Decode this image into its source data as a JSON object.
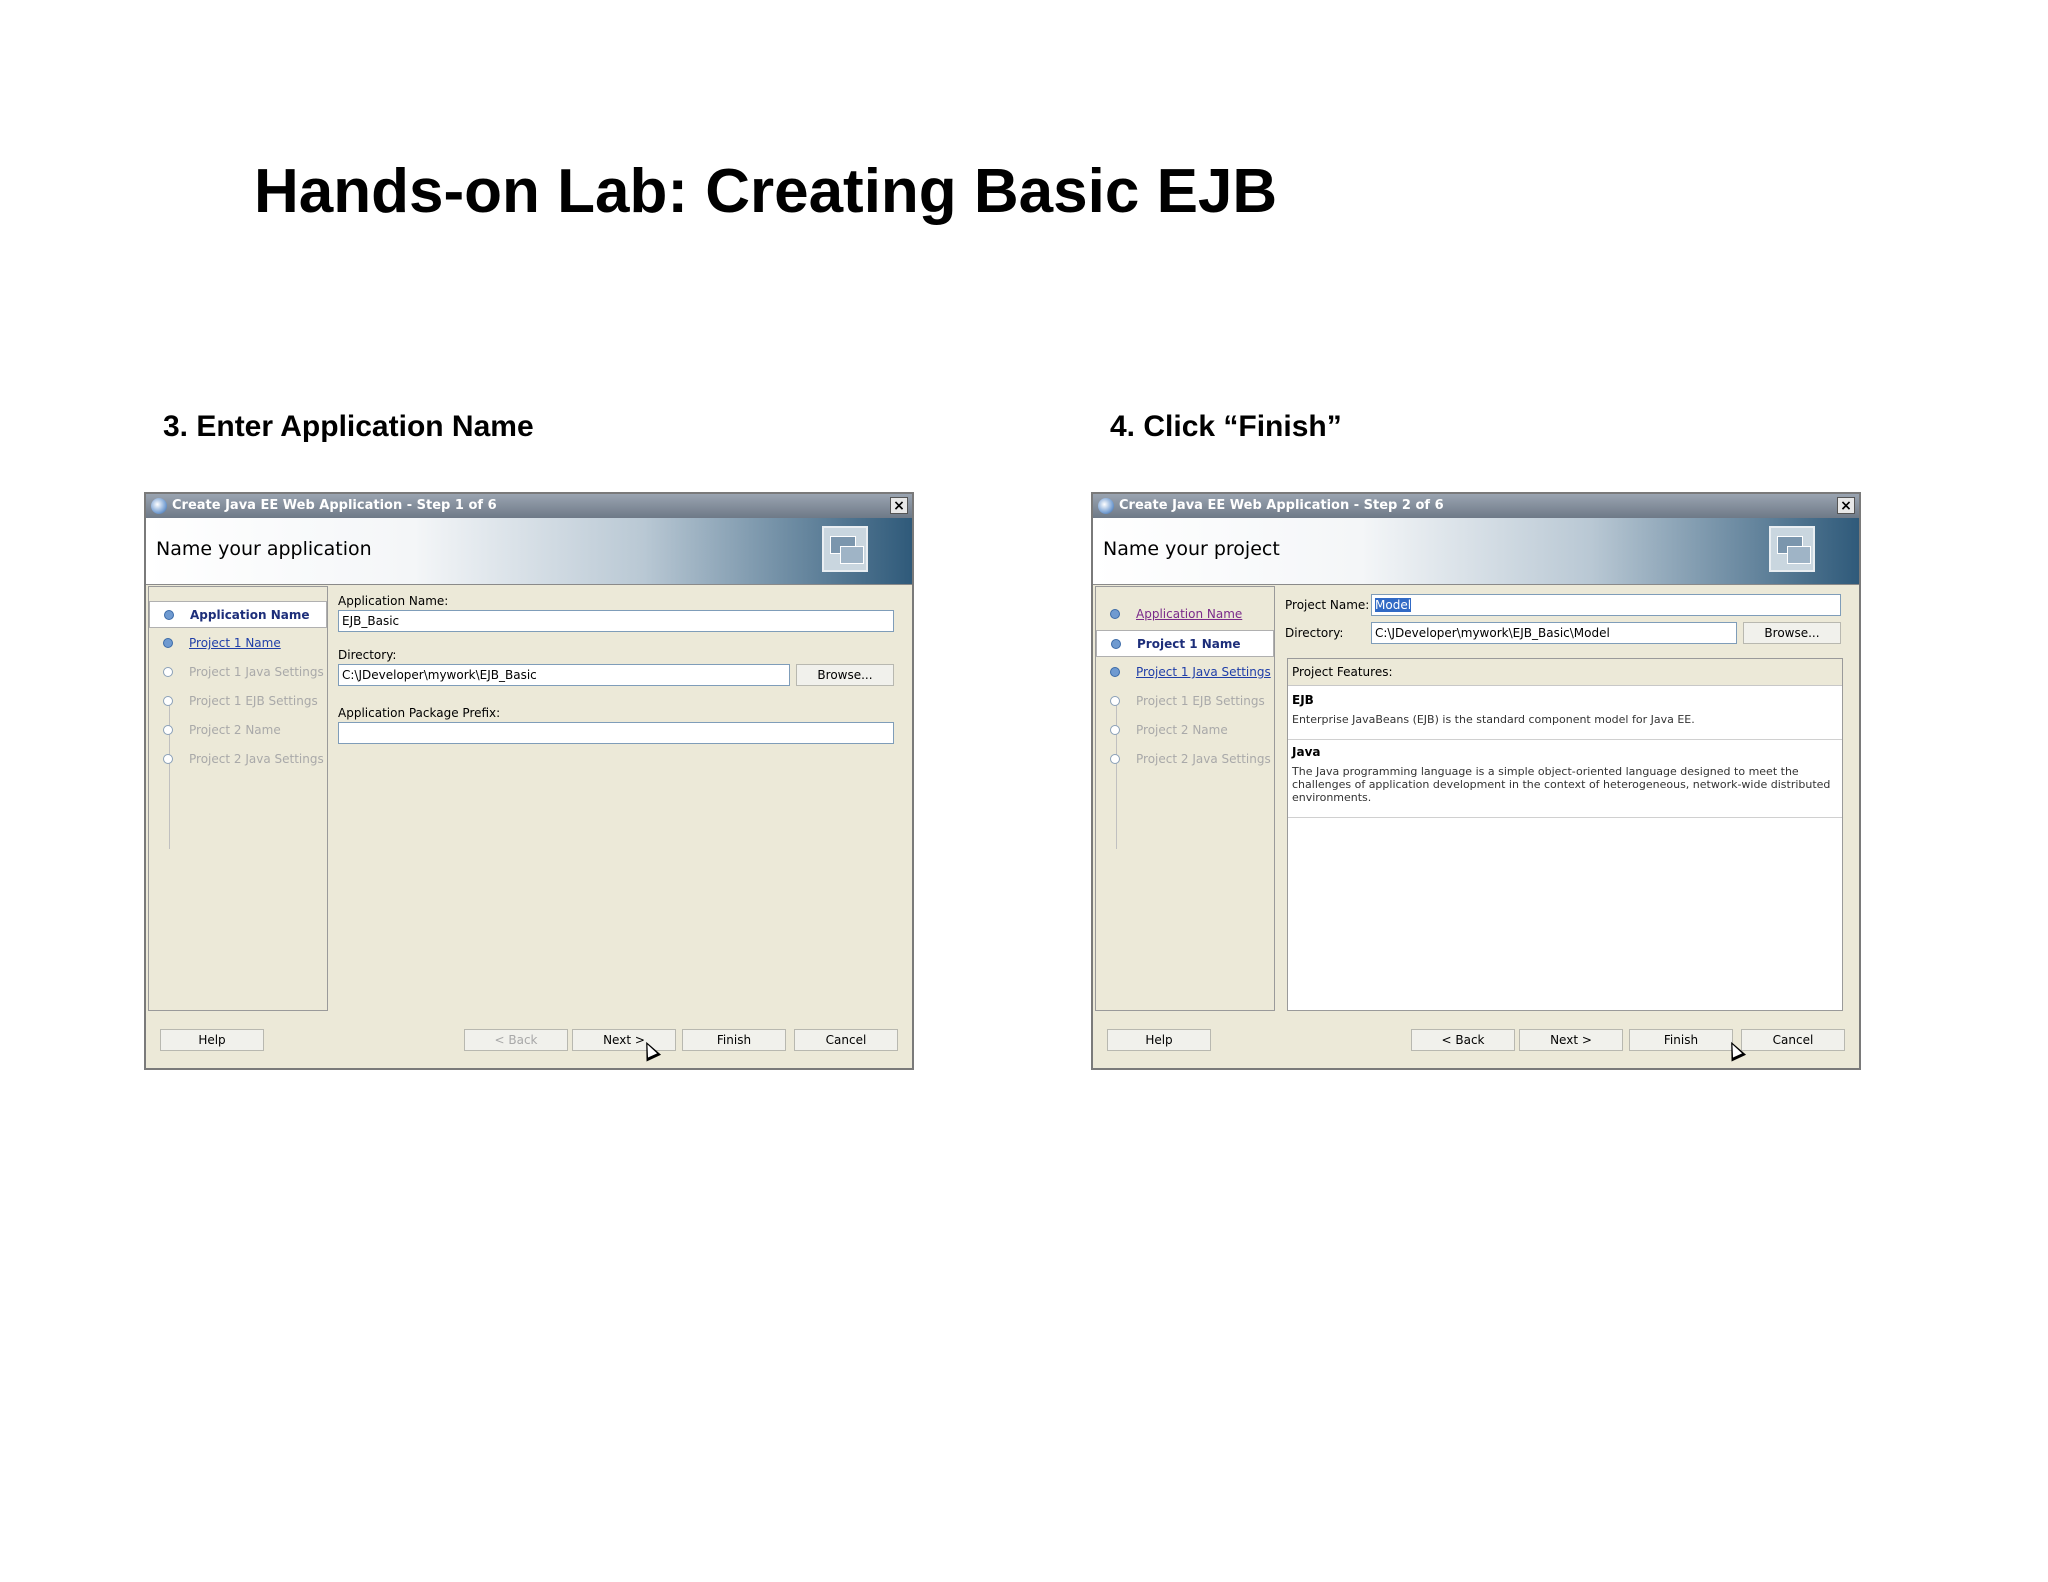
{
  "slide": {
    "title": "Hands-on Lab: Creating Basic EJB"
  },
  "step3": {
    "caption": "3. Enter Application Name",
    "dialog": {
      "window_title": "Create Java EE Web Application - Step 1 of 6",
      "banner_title": "Name your application",
      "nav": [
        {
          "label": "Application Name",
          "state": "selected"
        },
        {
          "label": "Project 1 Name",
          "state": "link"
        },
        {
          "label": "Project 1 Java Settings",
          "state": "disabled"
        },
        {
          "label": "Project 1 EJB Settings",
          "state": "disabled"
        },
        {
          "label": "Project 2 Name",
          "state": "disabled"
        },
        {
          "label": "Project 2 Java Settings",
          "state": "disabled"
        }
      ],
      "app_name_label": "Application Name:",
      "app_name_value": "EJB_Basic",
      "directory_label": "Directory:",
      "directory_value": "C:\\JDeveloper\\mywork\\EJB_Basic",
      "browse_label": "Browse...",
      "package_prefix_label": "Application Package Prefix:",
      "package_prefix_value": "",
      "buttons": {
        "help": "Help",
        "back": "< Back",
        "next": "Next >",
        "finish": "Finish",
        "cancel": "Cancel"
      }
    }
  },
  "step4": {
    "caption": "4. Click “Finish”",
    "dialog": {
      "window_title": "Create Java EE Web Application - Step 2 of 6",
      "banner_title": "Name your project",
      "nav": [
        {
          "label": "Application Name",
          "state": "visited"
        },
        {
          "label": "Project 1 Name",
          "state": "selected"
        },
        {
          "label": "Project 1 Java Settings",
          "state": "link"
        },
        {
          "label": "Project 1 EJB Settings",
          "state": "disabled"
        },
        {
          "label": "Project 2 Name",
          "state": "disabled"
        },
        {
          "label": "Project 2 Java Settings",
          "state": "disabled"
        }
      ],
      "project_name_label": "Project Name:",
      "project_name_value": "Model",
      "directory_label": "Directory:",
      "directory_value": "C:\\JDeveloper\\mywork\\EJB_Basic\\Model",
      "browse_label": "Browse...",
      "features_label": "Project Features:",
      "features": [
        {
          "name": "EJB",
          "description": "Enterprise JavaBeans (EJB) is the standard component model for Java EE."
        },
        {
          "name": "Java",
          "description": "The Java programming language is a simple object-oriented language designed to meet the challenges of application development in the context of heterogeneous, network-wide distributed environments."
        }
      ],
      "buttons": {
        "help": "Help",
        "back": "< Back",
        "next": "Next >",
        "finish": "Finish",
        "cancel": "Cancel"
      }
    }
  }
}
